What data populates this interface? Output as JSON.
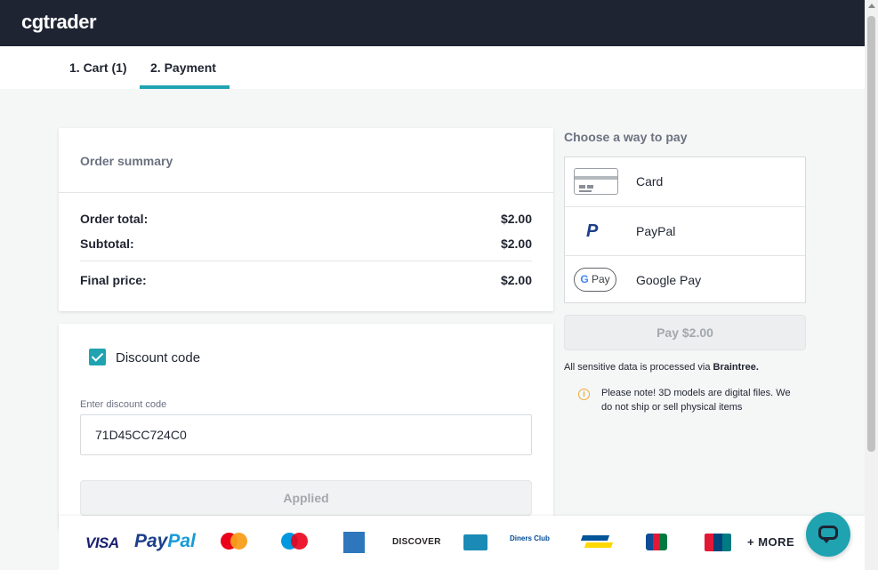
{
  "header": {
    "logo": "cgtrader"
  },
  "tabs": [
    {
      "label": "1. Cart (1)"
    },
    {
      "label": "2. Payment",
      "active": true
    }
  ],
  "summary": {
    "title": "Order summary",
    "rows": [
      {
        "label": "Order total:",
        "amount": "$2.00"
      },
      {
        "label": "Subtotal:",
        "amount": "$2.00"
      },
      {
        "label": "Final price:",
        "amount": "$2.00"
      }
    ]
  },
  "discount": {
    "checkbox_label": "Discount code",
    "checked": true,
    "field_label": "Enter discount code",
    "value": "71D45CC724C0",
    "button_label": "Applied"
  },
  "payment": {
    "title": "Choose a way to pay",
    "methods": [
      {
        "label": "Card",
        "icon": "credit-card-icon"
      },
      {
        "label": "PayPal",
        "icon": "paypal-icon"
      },
      {
        "label": "Google Pay",
        "icon": "google-pay-icon",
        "icon_text": "Pay"
      }
    ],
    "pay_button": "Pay $2.00",
    "sensitive_prefix": "All sensitive data is processed via ",
    "sensitive_brand": "Braintree.",
    "note": "Please note! 3D models are digital files. We do not ship or sell physical items"
  },
  "footer": {
    "logos": {
      "visa": "VISA",
      "paypal_a": "Pay",
      "paypal_b": "Pal",
      "discover": "DISCOVER",
      "diners": "Diners Club",
      "jcb": "JCB"
    },
    "more": "+ MORE"
  },
  "colors": {
    "accent": "#1fa3b1",
    "topbar": "#1e2432",
    "warning": "#f0a93b"
  }
}
